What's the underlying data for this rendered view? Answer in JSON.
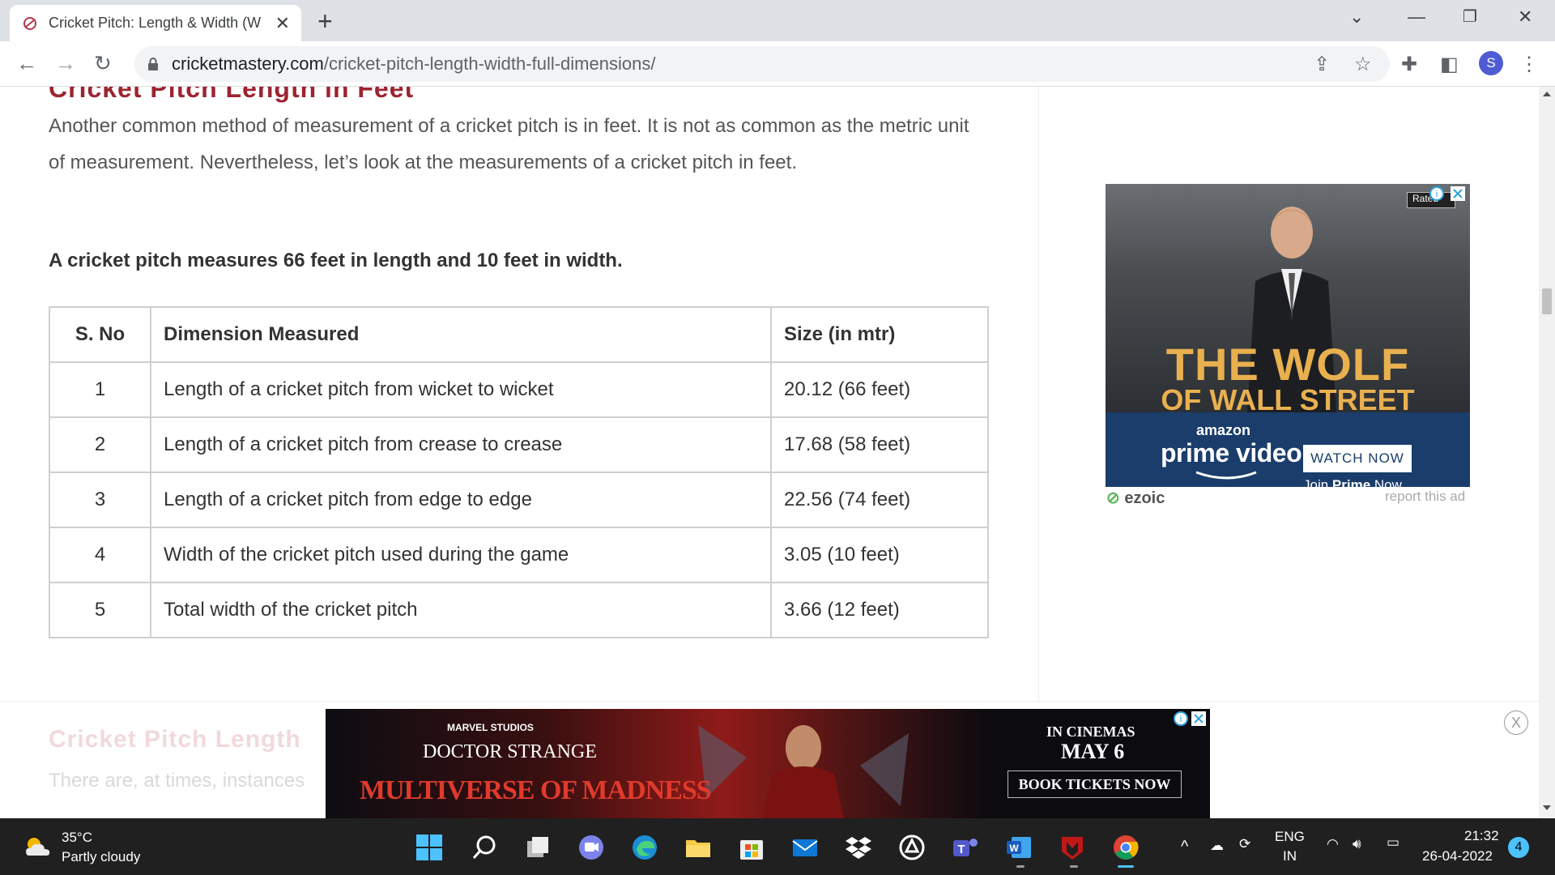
{
  "browser": {
    "tab_title": "Cricket Pitch: Length & Width (W",
    "url_domain": "cricketmastery.com",
    "url_path": "/cricket-pitch-length-width-full-dimensions/",
    "profile_initial": "S"
  },
  "article": {
    "section_heading": "Cricket Pitch Length in Feet",
    "paragraph": "Another common method of measurement of a cricket pitch is in feet. It is not as common as the metric unit of measurement. Nevertheless, let’s look at the measurements of a cricket pitch in feet.",
    "bold_statement": "A cricket pitch measures 66 feet in length and 10 feet in width.",
    "table": {
      "headers": [
        "S. No",
        "Dimension Measured",
        "Size (in mtr)"
      ],
      "rows": [
        [
          "1",
          "Length of a cricket pitch from wicket to wicket",
          "20.12 (66 feet)"
        ],
        [
          "2",
          "Length of a cricket pitch from crease to crease",
          "17.68 (58 feet)"
        ],
        [
          "3",
          "Length of a cricket pitch from edge to edge",
          "22.56 (74 feet)"
        ],
        [
          "4",
          "Width of the cricket pitch used during the game",
          "3.05 (10 feet)"
        ],
        [
          "5",
          "Total width of the cricket pitch",
          "3.66 (12 feet)"
        ]
      ]
    },
    "next_heading": "Cricket Pitch Length",
    "next_paragraph": "There are, at times, instances"
  },
  "ad_right": {
    "rated": "Rated",
    "title_line1": "THE WOLF",
    "title_line2": "OF WALL STREET",
    "brand_top": "amazon",
    "brand": "prime video",
    "cta": "WATCH NOW",
    "join_prefix": "Join ",
    "join_bold": "Prime",
    "join_suffix": " Now",
    "ezoic": "ezoic",
    "report": "report this ad"
  },
  "banner_ad": {
    "studio": "MARVEL STUDIOS",
    "title": "DOCTOR STRANGE",
    "subtitle": "MULTIVERSE OF MADNESS",
    "in_cinemas": "IN CINEMAS",
    "date": "MAY 6",
    "cta": "BOOK TICKETS NOW",
    "close": "X"
  },
  "taskbar": {
    "temperature": "35°C",
    "weather": "Partly cloudy",
    "lang_top": "ENG",
    "lang_bottom": "IN",
    "time": "21:32",
    "date": "26-04-2022",
    "notifications": "4"
  },
  "colors": {
    "heading": "#9c2430",
    "prime_blue": "#1a3d6b",
    "wolf_gold": "#e9b04f"
  }
}
